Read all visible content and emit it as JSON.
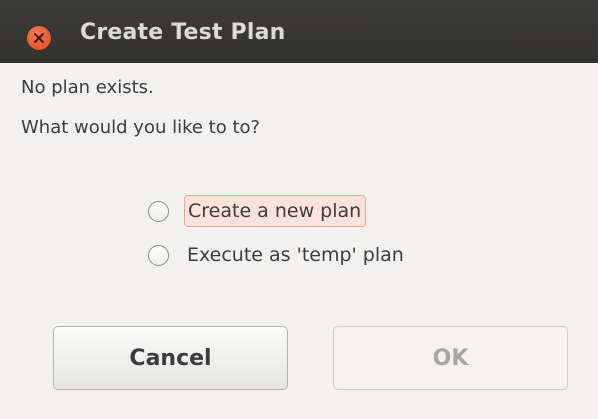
{
  "window": {
    "title": "Create Test Plan"
  },
  "message": {
    "line1": "No plan exists.",
    "line2": "What would you like to to?"
  },
  "options": [
    {
      "label": "Create a new plan",
      "selected": false,
      "focused": true
    },
    {
      "label": "Execute as 'temp' plan",
      "selected": false,
      "focused": false
    }
  ],
  "buttons": {
    "cancel": "Cancel",
    "ok": "OK",
    "ok_enabled": false
  },
  "colors": {
    "titlebar": "#3d3c38",
    "close_button": "#e3582e",
    "focus_highlight": "#fbe3dc"
  }
}
